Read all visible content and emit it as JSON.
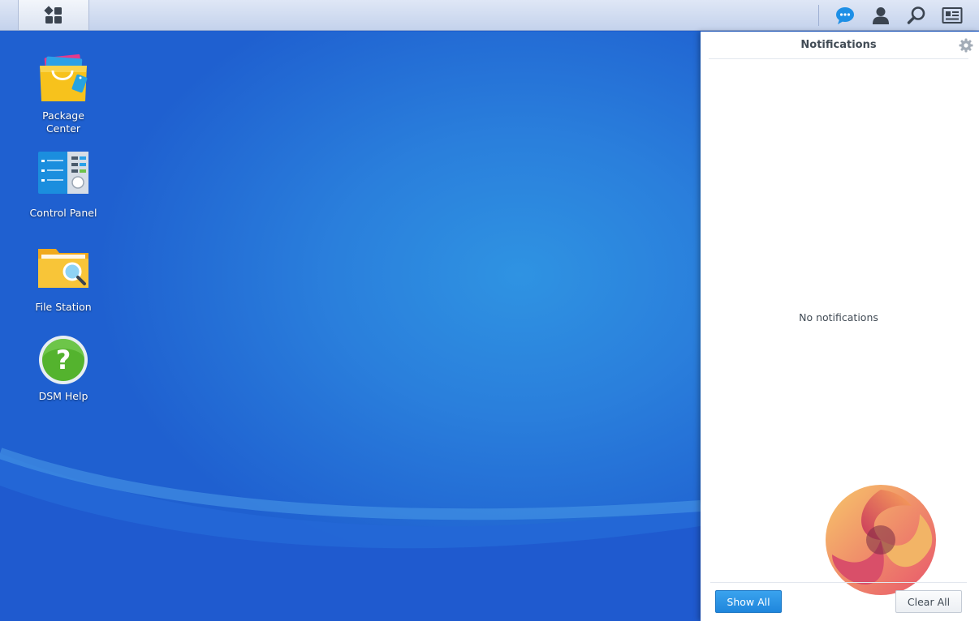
{
  "taskbar": {
    "main_menu_icon": "grid-menu-icon",
    "icons": [
      "chat-bubble-icon",
      "user-icon",
      "search-icon",
      "widgets-icon"
    ]
  },
  "desktop": {
    "icons": [
      {
        "label_line1": "Package",
        "label_line2": "Center",
        "icon": "shopping-bag-icon"
      },
      {
        "label": "Control Panel",
        "icon": "control-panel-icon"
      },
      {
        "label": "File Station",
        "icon": "folder-search-icon"
      },
      {
        "label": "DSM Help",
        "icon": "help-question-icon"
      }
    ]
  },
  "notifications": {
    "title": "Notifications",
    "empty_text": "No notifications",
    "show_all_label": "Show All",
    "clear_all_label": "Clear All"
  },
  "colors": {
    "accent": "#1f86dc",
    "desktop_bg": "#2a7fdc",
    "taskbar_bg": "#d0dbef"
  }
}
